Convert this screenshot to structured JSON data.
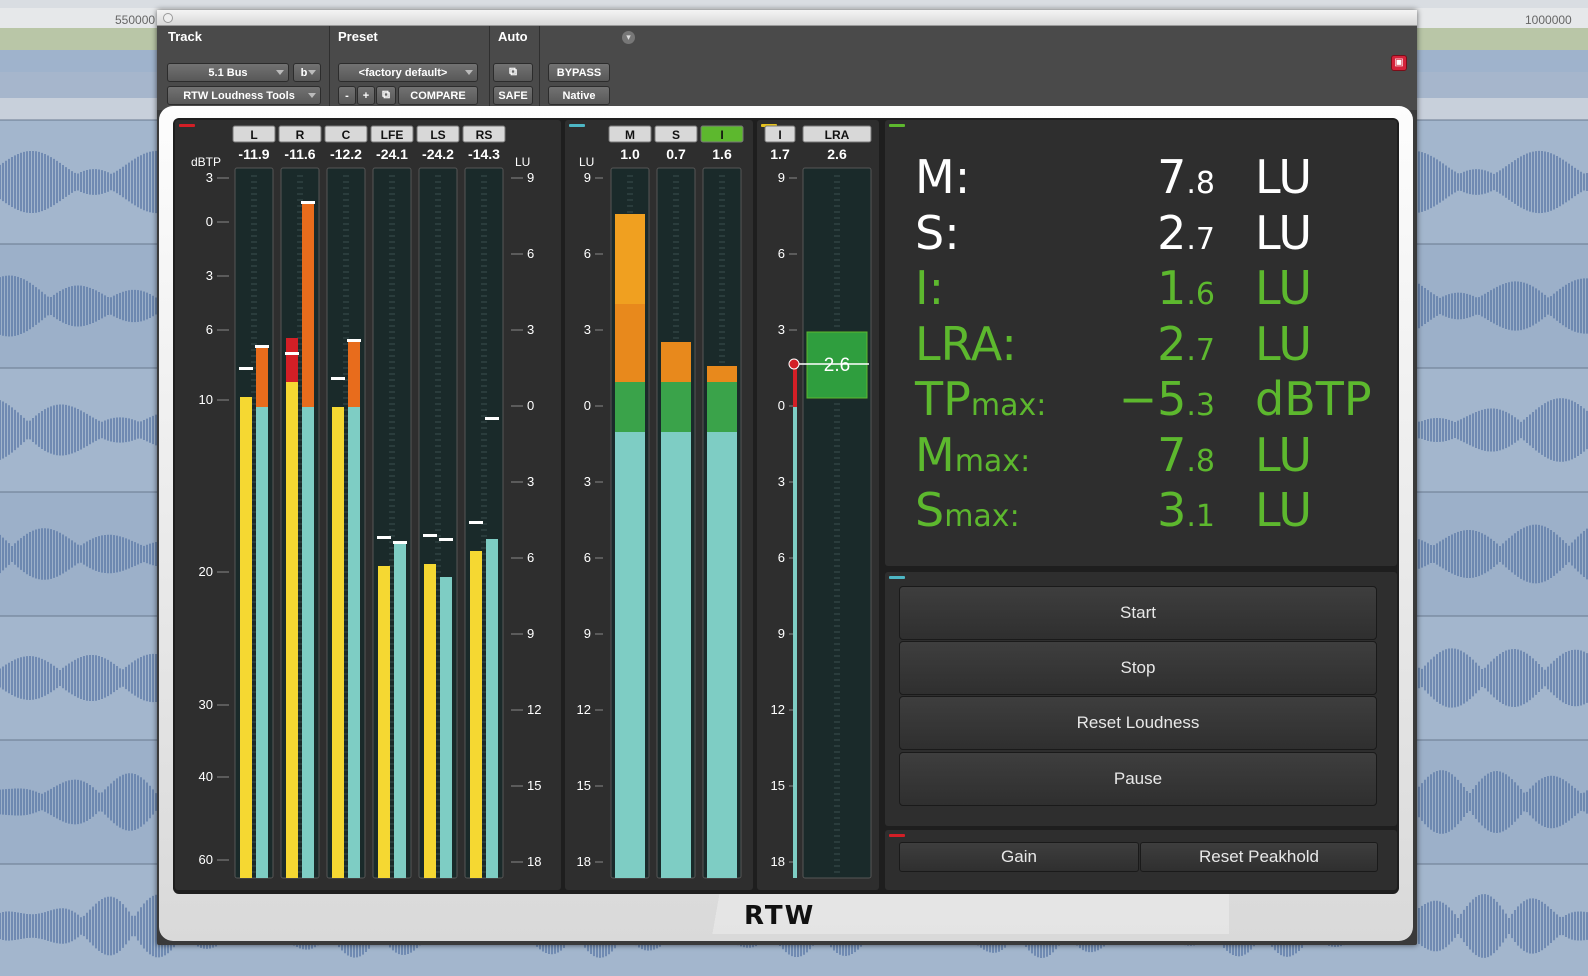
{
  "timeline": {
    "ruler_left": "550000",
    "ruler_right": "1000000"
  },
  "header": {
    "track_label": "Track",
    "preset_label": "Preset",
    "auto_label": "Auto",
    "track_name": "5.1 Bus",
    "track_variant": "b",
    "plugin_name": "RTW Loudness Tools",
    "preset_name": "<factory default>",
    "preset_minus": "-",
    "preset_plus": "+",
    "compare": "COMPARE",
    "safe": "SAFE",
    "bypass": "BYPASS",
    "native": "Native"
  },
  "channel_meter": {
    "unit_left": "dBTP",
    "unit_right": "LU",
    "channels": [
      {
        "name": "L",
        "value": "-11.9"
      },
      {
        "name": "R",
        "value": "-11.6"
      },
      {
        "name": "C",
        "value": "-12.2"
      },
      {
        "name": "LFE",
        "value": "-24.1"
      },
      {
        "name": "LS",
        "value": "-24.2"
      },
      {
        "name": "RS",
        "value": "-14.3"
      }
    ],
    "left_scale": [
      "3",
      "0",
      "3",
      "6",
      "10",
      "20",
      "30",
      "40",
      "60"
    ],
    "right_scale": [
      "9",
      "6",
      "3",
      "0",
      "3",
      "6",
      "9",
      "12",
      "15",
      "18"
    ]
  },
  "loudness_meter": {
    "unit": "LU",
    "bars": [
      {
        "name": "M",
        "value": "1.0"
      },
      {
        "name": "S",
        "value": "0.7"
      },
      {
        "name": "I",
        "value": "1.6"
      }
    ],
    "scale": [
      "9",
      "6",
      "3",
      "0",
      "3",
      "6",
      "9",
      "12",
      "15",
      "18"
    ]
  },
  "lra_meter": {
    "i_label": "I",
    "i_value": "1.7",
    "lra_label": "LRA",
    "lra_value": "2.6",
    "marker_value": "2.6",
    "scale": [
      "9",
      "6",
      "3",
      "0",
      "3",
      "6",
      "9",
      "12",
      "15",
      "18"
    ]
  },
  "readouts": [
    {
      "name": "M:",
      "sub": "",
      "value": "7",
      "decimal": ".8",
      "unit": "LU",
      "color": "#ffffff"
    },
    {
      "name": "S:",
      "sub": "",
      "value": "2",
      "decimal": ".7",
      "unit": "LU",
      "color": "#ffffff"
    },
    {
      "name": "I:",
      "sub": "",
      "value": "1",
      "decimal": ".6",
      "unit": "LU",
      "color": "#5db82e"
    },
    {
      "name": "LRA:",
      "sub": "",
      "value": "2",
      "decimal": ".7",
      "unit": "LU",
      "color": "#5db82e"
    },
    {
      "name": "TP",
      "sub": "max:",
      "value": "−5",
      "decimal": ".3",
      "unit": "dBTP",
      "color": "#5db82e"
    },
    {
      "name": "M",
      "sub": "max:",
      "value": "7",
      "decimal": ".8",
      "unit": "LU",
      "color": "#5db82e"
    },
    {
      "name": "S",
      "sub": "max:",
      "value": "3",
      "decimal": ".1",
      "unit": "LU",
      "color": "#5db82e"
    }
  ],
  "controls": {
    "start": "Start",
    "stop": "Stop",
    "reset_loudness": "Reset Loudness",
    "pause": "Pause",
    "gain": "Gain",
    "reset_peakhold": "Reset Peakhold"
  },
  "brand": "RTW",
  "colors": {
    "accent_green": "#5db82e",
    "meter_teal": "#7ecdc4",
    "meter_yellow": "#f5d832",
    "meter_orange": "#e86c1c",
    "meter_red": "#d31f26"
  }
}
